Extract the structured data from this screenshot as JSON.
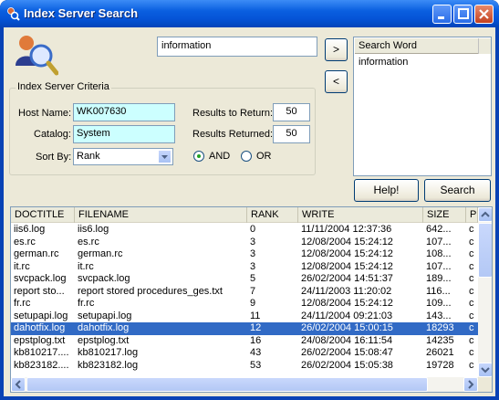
{
  "window": {
    "title": "Index Server Search"
  },
  "query": {
    "value": "information"
  },
  "buttons": {
    "add": ">",
    "remove": "<",
    "help": "Help!",
    "search": "Search"
  },
  "search_words": {
    "header": "Search Word",
    "items": [
      "information"
    ]
  },
  "criteria": {
    "legend": "Index Server Criteria",
    "host_label": "Host Name:",
    "host_value": "WK007630",
    "catalog_label": "Catalog:",
    "catalog_value": "System",
    "sortby_label": "Sort By:",
    "sortby_value": "Rank",
    "results_to_return_label": "Results to Return:",
    "results_to_return_value": "50",
    "results_returned_label": "Results Returned:",
    "results_returned_value": "50",
    "and_label": "AND",
    "or_label": "OR",
    "selected": "AND"
  },
  "table": {
    "columns": [
      "DOCTITLE",
      "FILENAME",
      "RANK",
      "WRITE",
      "SIZE",
      "P"
    ],
    "rows": [
      [
        "iis6.log",
        "iis6.log",
        "0",
        "11/11/2004 12:37:36",
        "642...",
        "c"
      ],
      [
        "es.rc",
        "es.rc",
        "3",
        "12/08/2004 15:24:12",
        "107...",
        "c"
      ],
      [
        "german.rc",
        "german.rc",
        "3",
        "12/08/2004 15:24:12",
        "108...",
        "c"
      ],
      [
        "it.rc",
        "it.rc",
        "3",
        "12/08/2004 15:24:12",
        "107...",
        "c"
      ],
      [
        "svcpack.log",
        "svcpack.log",
        "5",
        "26/02/2004 14:51:37",
        "189...",
        "c"
      ],
      [
        "report sto...",
        "report stored procedures_ges.txt",
        "7",
        "24/11/2003 11:20:02",
        "116...",
        "c"
      ],
      [
        "fr.rc",
        "fr.rc",
        "9",
        "12/08/2004 15:24:12",
        "109...",
        "c"
      ],
      [
        "setupapi.log",
        "setupapi.log",
        "11",
        "24/11/2004 09:21:03",
        "143...",
        "c"
      ],
      [
        "dahotfix.log",
        "dahotfix.log",
        "12",
        "26/02/2004 15:00:15",
        "18293",
        "c"
      ],
      [
        "epstplog.txt",
        "epstplog.txt",
        "16",
        "24/08/2004 16:11:54",
        "14235",
        "c"
      ],
      [
        "kb810217....",
        "kb810217.log",
        "43",
        "26/02/2004 15:08:47",
        "26021",
        "c"
      ],
      [
        "kb823182....",
        "kb823182.log",
        "53",
        "26/02/2004 15:05:38",
        "19728",
        "c"
      ]
    ],
    "selected_row": 8
  },
  "icons": [
    "app-icon",
    "search-logo-icon",
    "minimize-icon",
    "maximize-icon",
    "close-icon",
    "dropdown-arrow-icon",
    "scroll-up-icon",
    "scroll-down-icon",
    "scroll-left-icon",
    "scroll-right-icon"
  ],
  "colors": {
    "titlebar": "#0553d6",
    "selection": "#316ac5",
    "field_highlight": "#ccffff"
  }
}
